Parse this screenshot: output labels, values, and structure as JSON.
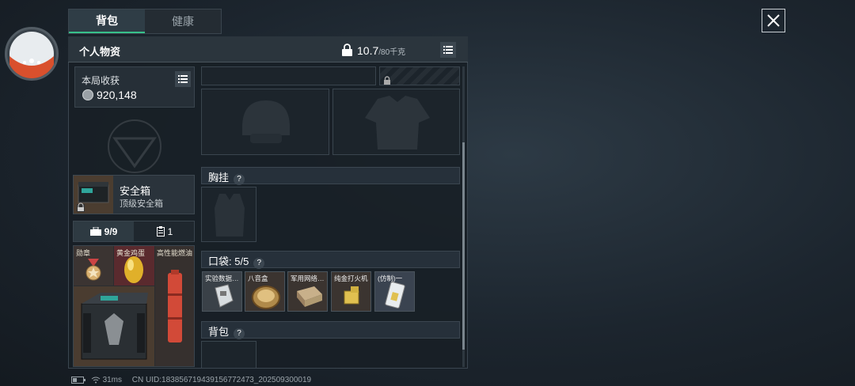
{
  "tabs": [
    {
      "label": "背包",
      "active": true
    },
    {
      "label": "健康",
      "active": false
    }
  ],
  "header": {
    "title": "个人物资",
    "weight_current": "10.7",
    "weight_max": "/80千克"
  },
  "loot": {
    "title": "本局收获",
    "value": "920,148"
  },
  "safebox": {
    "name": "安全箱",
    "subtitle": "顶级安全箱"
  },
  "container_tabs": {
    "slots": "9/9",
    "count": "1"
  },
  "safe_items": [
    {
      "label": "勋章"
    },
    {
      "label": "黄金鸡蛋"
    },
    {
      "label": "高性能燃油"
    }
  ],
  "sections": {
    "chest_rig": "胸挂",
    "pocket": "口袋:  5/5",
    "backpack": "背包"
  },
  "pocket_items": [
    {
      "label": "实验数据…"
    },
    {
      "label": "八音盒"
    },
    {
      "label": "军用网络…"
    },
    {
      "label": "纯金打火机"
    },
    {
      "label": "(仿制)一"
    }
  ],
  "status": {
    "ping": "31ms",
    "uid": "CN UID:1838567194391567724​73_202509300019"
  },
  "colors": {
    "accent": "#37c08a",
    "gold_item_bg": "#7a5a2a",
    "red_item_bg": "#5a2a2e"
  }
}
